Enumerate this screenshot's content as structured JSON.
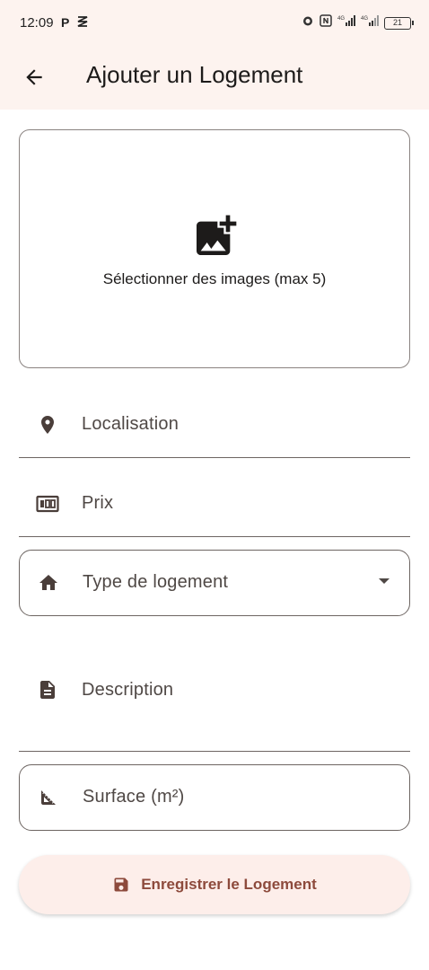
{
  "status_bar": {
    "time": "12:09",
    "left_icons": [
      "P",
      "ⵈ"
    ],
    "battery_level": "21"
  },
  "app_bar": {
    "title": "Ajouter un Logement"
  },
  "image_picker": {
    "label": "Sélectionner des images (max 5)"
  },
  "form": {
    "location_label": "Localisation",
    "price_label": "Prix",
    "type_label": "Type de logement",
    "description_label": "Description",
    "surface_label": "Surface (m²)"
  },
  "save_button": {
    "label": "Enregistrer le Logement"
  },
  "colors": {
    "appbar_bg": "#fdf3ef",
    "accent": "#8d4a3c",
    "icon": "#4a3e3a",
    "button_bg": "#fdeeea"
  }
}
